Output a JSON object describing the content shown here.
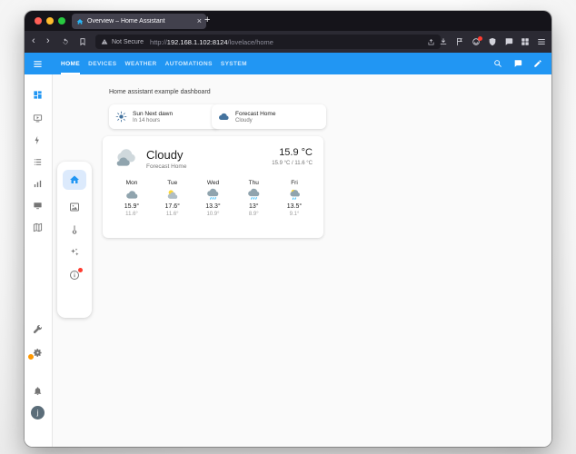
{
  "browser": {
    "tab": {
      "title": "Overview – Home Assistant",
      "close_glyph": "×"
    },
    "new_tab_glyph": "+",
    "nav": {
      "back_glyph": "‹",
      "forward_glyph": "›"
    },
    "urlbar": {
      "security_label": "Not Secure",
      "scheme": "http://",
      "host": "192.168.1.102:8124",
      "path": "/lovelace/home"
    }
  },
  "ha": {
    "toolbar": {
      "tabs": [
        {
          "label": "HOME"
        },
        {
          "label": "DEVICES"
        },
        {
          "label": "WEATHER"
        },
        {
          "label": "AUTOMATIONS"
        },
        {
          "label": "SYSTEM"
        }
      ],
      "active_tab": "HOME"
    },
    "page_title": "Home assistant example dashboard",
    "entity_cards": [
      {
        "title": "Sun Next dawn",
        "subtitle": "In 14 hours",
        "icon": "sun-icon"
      },
      {
        "title": "Forecast Home",
        "subtitle": "Cloudy",
        "icon": "cloud-icon"
      }
    ],
    "weather_card": {
      "state": "Cloudy",
      "entity_name": "Forecast Home",
      "temperature": "15.9 °C",
      "today_range": "15.9 °C / 11.6 °C",
      "forecast": [
        {
          "day": "Mon",
          "hi": "15.9°",
          "lo": "11.6°",
          "icon": "cloudy"
        },
        {
          "day": "Tue",
          "hi": "17.6°",
          "lo": "11.6°",
          "icon": "partly-sunny"
        },
        {
          "day": "Wed",
          "hi": "13.3°",
          "lo": "10.9°",
          "icon": "rainy"
        },
        {
          "day": "Thu",
          "hi": "13°",
          "lo": "8.9°",
          "icon": "rainy"
        },
        {
          "day": "Fri",
          "hi": "13.5°",
          "lo": "9.1°",
          "icon": "partly-rainy"
        }
      ]
    },
    "sidebar": {
      "avatar_initial": "j"
    },
    "colors": {
      "primary": "#2196f3",
      "entity_icon": "#44739e",
      "badge_red": "#f44336",
      "badge_orange": "#ff9800"
    }
  }
}
